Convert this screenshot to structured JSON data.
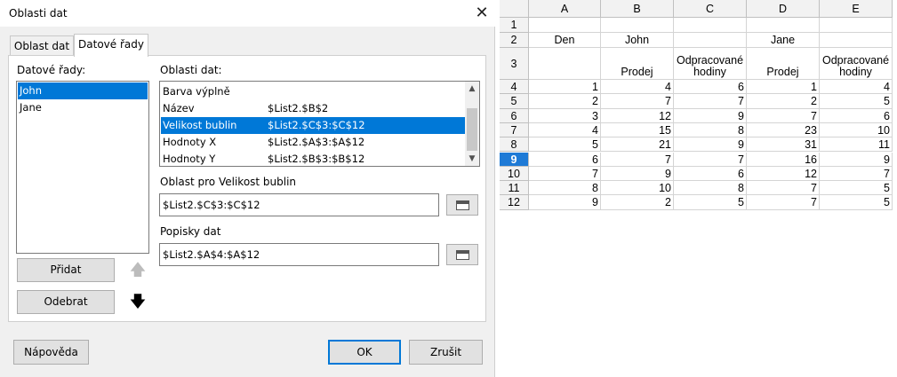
{
  "dialog": {
    "title": "Oblasti dat",
    "close_glyph": "✕",
    "tabs": [
      {
        "label": "Oblast dat",
        "active": false
      },
      {
        "label": "Datové řady",
        "active": true
      }
    ],
    "series_label": "Datové řady:",
    "series": [
      {
        "label": "John",
        "selected": true
      },
      {
        "label": "Jane",
        "selected": false
      }
    ],
    "ranges_label": "Oblasti dat:",
    "ranges": [
      {
        "role": "Barva výplně",
        "range": "",
        "selected": false
      },
      {
        "role": "Název",
        "range": "$List2.$B$2",
        "selected": false
      },
      {
        "role": "Velikost bublin",
        "range": "$List2.$C$3:$C$12",
        "selected": true
      },
      {
        "role": "Hodnoty X",
        "range": "$List2.$A$3:$A$12",
        "selected": false
      },
      {
        "role": "Hodnoty Y",
        "range": "$List2.$B$3:$B$12",
        "selected": false
      }
    ],
    "range_for_label": "Oblast pro Velikost bublin",
    "range_for_value": "$List2.$C$3:$C$12",
    "labels_label": "Popisky dat",
    "labels_value": "$List2.$A$4:$A$12",
    "add_button": "Přidat",
    "remove_button": "Odebrat",
    "up_glyph": "🡅",
    "down_glyph": "🡇",
    "help_button": "Nápověda",
    "ok_button": "OK",
    "cancel_button": "Zrušit",
    "colors": {
      "selection": "#0078d7",
      "accent": "#0078d7"
    }
  },
  "sheet": {
    "columns": [
      "A",
      "B",
      "C",
      "D",
      "E"
    ],
    "active_row": "9",
    "rows": [
      {
        "n": "1",
        "cells": [
          "",
          "",
          "",
          "",
          ""
        ]
      },
      {
        "n": "2",
        "cells": [
          "Den",
          "John",
          "",
          "Jane",
          ""
        ]
      },
      {
        "n": "3",
        "cells": [
          "",
          "Prodej",
          "Odpracované hodiny",
          "Prodej",
          "Odpracované hodiny"
        ]
      },
      {
        "n": "4",
        "cells": [
          "1",
          "4",
          "6",
          "1",
          "4"
        ]
      },
      {
        "n": "5",
        "cells": [
          "2",
          "7",
          "7",
          "2",
          "5"
        ]
      },
      {
        "n": "6",
        "cells": [
          "3",
          "12",
          "9",
          "7",
          "6"
        ]
      },
      {
        "n": "7",
        "cells": [
          "4",
          "15",
          "8",
          "23",
          "10"
        ]
      },
      {
        "n": "8",
        "cells": [
          "5",
          "21",
          "9",
          "31",
          "11"
        ]
      },
      {
        "n": "9",
        "cells": [
          "6",
          "7",
          "7",
          "16",
          "9"
        ]
      },
      {
        "n": "10",
        "cells": [
          "7",
          "9",
          "6",
          "12",
          "7"
        ]
      },
      {
        "n": "11",
        "cells": [
          "8",
          "10",
          "8",
          "7",
          "5"
        ]
      },
      {
        "n": "12",
        "cells": [
          "9",
          "2",
          "5",
          "7",
          "5"
        ]
      }
    ]
  }
}
